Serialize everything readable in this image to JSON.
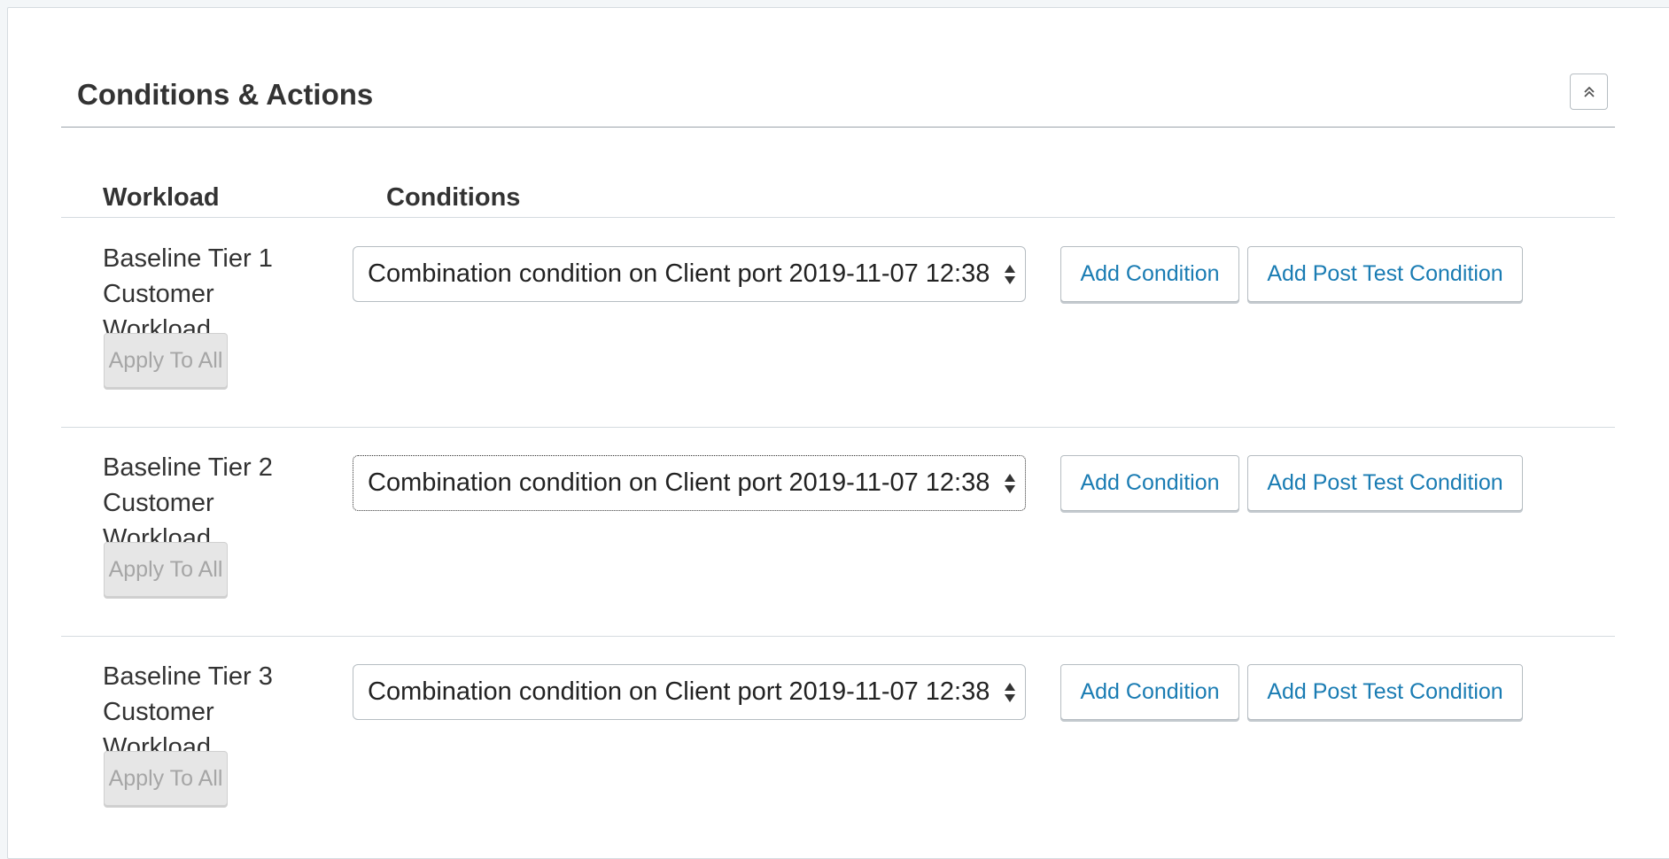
{
  "section": {
    "title": "Conditions & Actions",
    "collapse_icon": "double-chevron-up-icon"
  },
  "columns": {
    "workload": "Workload",
    "conditions": "Conditions"
  },
  "rows": [
    {
      "workload_line1": "Baseline Tier 1",
      "workload_line2": "Customer Workload",
      "apply_label": "Apply To All",
      "condition_value": "Combination condition on Client port 2019-11-07 12:38",
      "add_condition_label": "Add Condition",
      "add_post_label": "Add Post Test Condition"
    },
    {
      "workload_line1": "Baseline Tier 2",
      "workload_line2": "Customer Workload",
      "apply_label": "Apply To All",
      "condition_value": "Combination condition on Client port 2019-11-07 12:38",
      "add_condition_label": "Add Condition",
      "add_post_label": "Add Post Test Condition"
    },
    {
      "workload_line1": "Baseline Tier 3",
      "workload_line2": "Customer Workload",
      "apply_label": "Apply To All",
      "condition_value": "Combination condition on Client port 2019-11-07 12:38",
      "add_condition_label": "Add Condition",
      "add_post_label": "Add Post Test Condition"
    }
  ],
  "colors": {
    "link": "#1a7cb3",
    "disabled_text": "#a6a6a6",
    "border": "#b6bdc2"
  }
}
